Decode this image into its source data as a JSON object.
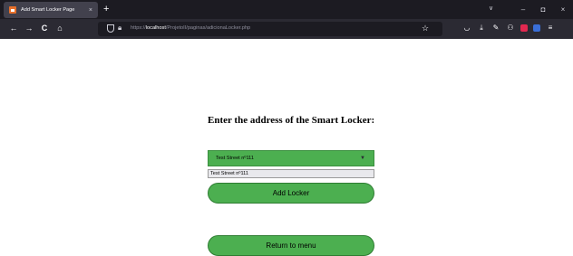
{
  "browser": {
    "tab_title": "Add Smart Locker Page",
    "tab_close": "×",
    "new_tab": "+",
    "back": "←",
    "forward": "→",
    "reload": "C",
    "home": "⌂",
    "url_prefix": "https://",
    "url_host": "localhost",
    "url_path": "/ProjetoII/paginas/adicionaLocker.php",
    "window_controls": {
      "chevron": "∨",
      "minimize": "–",
      "maximize": "◘",
      "close": "×"
    }
  },
  "page": {
    "heading": "Enter the address of the Smart Locker:",
    "select": {
      "selected": "Test Street nº111",
      "options": [
        "Test Street nº111"
      ]
    },
    "add_button": "Add Locker",
    "return_button": "Return to menu"
  },
  "colors": {
    "accent_green": "#4caf50",
    "chrome_dark": "#1c1b22",
    "chrome_toolbar": "#2b2a33"
  },
  "icons": [
    "firefox-tab-favicon",
    "shield-icon",
    "lock-icon",
    "star-icon",
    "pocket-icon",
    "download-icon",
    "tools-icon",
    "extensions-icon",
    "menu-icon"
  ]
}
